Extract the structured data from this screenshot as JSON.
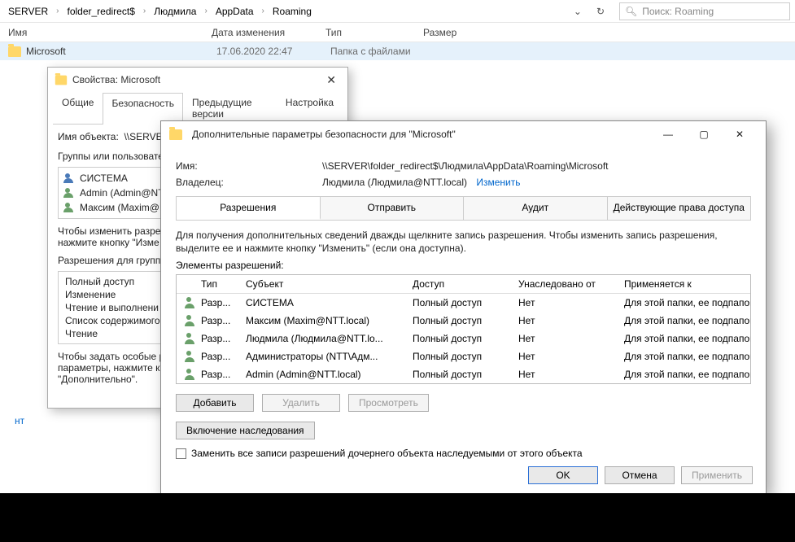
{
  "breadcrumb": [
    "SERVER",
    "folder_redirect$",
    "Людмила",
    "AppData",
    "Roaming"
  ],
  "search_placeholder": "Поиск: Roaming",
  "columns": {
    "name": "Имя",
    "date": "Дата изменения",
    "type": "Тип",
    "size": "Размер"
  },
  "row": {
    "name": "Microsoft",
    "date": "17.06.2020 22:47",
    "type": "Папка с файлами"
  },
  "left_link": "нт",
  "props": {
    "title": "Свойства: Microsoft",
    "tabs": [
      "Общие",
      "Безопасность",
      "Предыдущие версии",
      "Настройка"
    ],
    "active_tab": 1,
    "obj_label": "Имя объекта:",
    "obj_value": "\\\\SERVER\\f...",
    "groups_label": "Группы или пользовате",
    "groups": [
      "СИСТЕМА",
      "Admin (Admin@NTT",
      "Максим (Maxim@N"
    ],
    "help1": "Чтобы изменить разре",
    "help2": "нажмите кнопку \"Изме",
    "perms_for": "Разрешения для групп",
    "perms": [
      "Полный доступ",
      "Изменение",
      "Чтение и выполнени",
      "Список содержимого",
      "Чтение"
    ],
    "help3a": "Чтобы задать особые р",
    "help3b": "параметры, нажмите к",
    "help3c": "\"Дополнительно\"."
  },
  "adv": {
    "title": "Дополнительные параметры безопасности для \"Microsoft\"",
    "name_label": "Имя:",
    "name_value": "\\\\SERVER\\folder_redirect$\\Людмила\\AppData\\Roaming\\Microsoft",
    "owner_label": "Владелец:",
    "owner_value": "Людмила (Людмила@NTT.local)",
    "owner_change": "Изменить",
    "tabs": [
      "Разрешения",
      "Отправить",
      "Аудит",
      "Действующие права доступа"
    ],
    "active_tab": 0,
    "help": "Для получения дополнительных сведений дважды щелкните запись разрешения. Чтобы изменить запись разрешения, выделите ее и нажмите кнопку \"Изменить\" (если она доступна).",
    "elements_label": "Элементы разрешений:",
    "head": {
      "type": "Тип",
      "subject": "Субъект",
      "access": "Доступ",
      "inherited": "Унаследовано от",
      "applies": "Применяется к"
    },
    "rows": [
      {
        "type": "Разр...",
        "subject": "СИСТЕМА",
        "access": "Полный доступ",
        "inherited": "Нет",
        "applies": "Для этой папки, ее подпапок ..."
      },
      {
        "type": "Разр...",
        "subject": "Максим (Maxim@NTT.local)",
        "access": "Полный доступ",
        "inherited": "Нет",
        "applies": "Для этой папки, ее подпапок ..."
      },
      {
        "type": "Разр...",
        "subject": "Людмила (Людмила@NTT.lo...",
        "access": "Полный доступ",
        "inherited": "Нет",
        "applies": "Для этой папки, ее подпапок ..."
      },
      {
        "type": "Разр...",
        "subject": "Администраторы (NTT\\Адм...",
        "access": "Полный доступ",
        "inherited": "Нет",
        "applies": "Для этой папки, ее подпапок ..."
      },
      {
        "type": "Разр...",
        "subject": "Admin (Admin@NTT.local)",
        "access": "Полный доступ",
        "inherited": "Нет",
        "applies": "Для этой папки, ее подпапок ..."
      }
    ],
    "btn_add": "Добавить",
    "btn_remove": "Удалить",
    "btn_view": "Просмотреть",
    "btn_enable_inh": "Включение наследования",
    "chk_replace": "Заменить все записи разрешений дочернего объекта наследуемыми от этого объекта",
    "btn_ok": "OK",
    "btn_cancel": "Отмена",
    "btn_apply": "Применить"
  }
}
